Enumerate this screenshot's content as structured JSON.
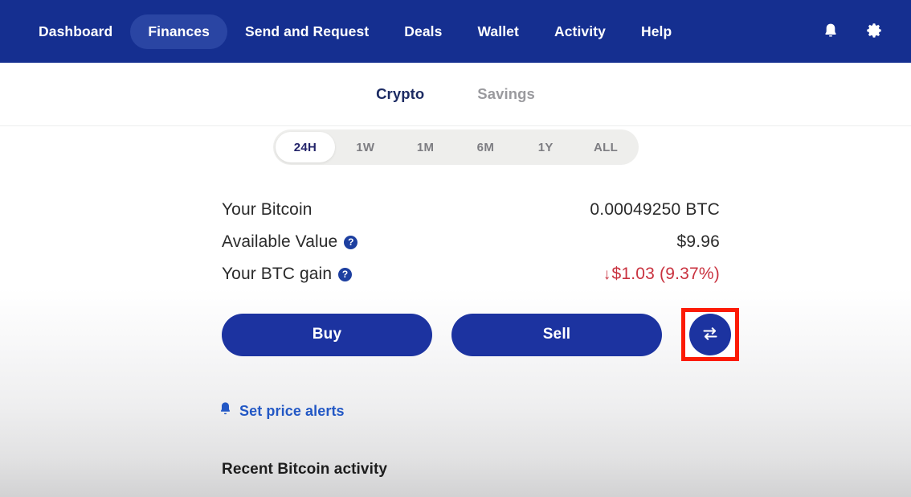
{
  "navbar": {
    "items": [
      {
        "label": "Dashboard",
        "active": false
      },
      {
        "label": "Finances",
        "active": true
      },
      {
        "label": "Send and Request",
        "active": false
      },
      {
        "label": "Deals",
        "active": false
      },
      {
        "label": "Wallet",
        "active": false
      },
      {
        "label": "Activity",
        "active": false
      },
      {
        "label": "Help",
        "active": false
      }
    ],
    "icons": {
      "notifications": "bell-icon",
      "settings": "gear-icon"
    },
    "background_color": "#152f90",
    "active_pill_color": "#2a45a3"
  },
  "tabs": [
    {
      "label": "Crypto",
      "active": true
    },
    {
      "label": "Savings",
      "active": false
    }
  ],
  "time_range": {
    "options": [
      "24H",
      "1W",
      "1M",
      "6M",
      "1Y",
      "ALL"
    ],
    "selected": "24H"
  },
  "stats": [
    {
      "label": "Your Bitcoin",
      "has_help": false,
      "value": "0.00049250 BTC",
      "negative": false
    },
    {
      "label": "Available Value",
      "has_help": true,
      "value": "$9.96",
      "negative": false
    },
    {
      "label": "Your BTC gain",
      "has_help": true,
      "value": "$1.03 (9.37%)",
      "arrow": "↓",
      "negative": true
    }
  ],
  "help_icon_glyph": "?",
  "actions": {
    "buy_label": "Buy",
    "sell_label": "Sell",
    "swap_icon": "exchange-arrows-icon",
    "primary_color": "#1c33a0",
    "highlight_color": "#fc1b05"
  },
  "price_alerts": {
    "label": "Set price alerts",
    "icon": "bell-icon",
    "link_color": "#2358c5"
  },
  "recent_activity": {
    "heading": "Recent Bitcoin activity"
  }
}
